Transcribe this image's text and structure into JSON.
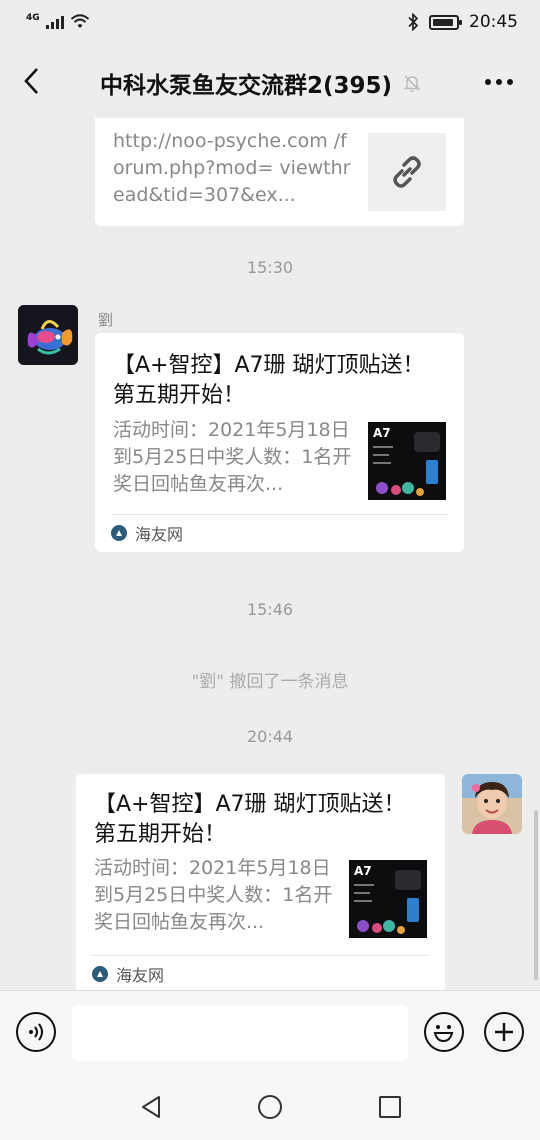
{
  "status_bar": {
    "network": "4G",
    "time": "20:45",
    "battery_level": 0.9
  },
  "nav": {
    "title": "中科水泵鱼友交流群2(395)"
  },
  "messages": {
    "link_card": {
      "url_text": "http://noo-psyche.com /forum.php?mod= viewthread&tid=307&ex..."
    },
    "time_1": "15:30",
    "msg_1": {
      "sender": "劉",
      "title": "【A+智控】A7珊 瑚灯顶贴送！第五期开始！",
      "desc": "活动时间：2021年5月18日到5月25日中奖人数：1名开奖日回帖鱼友再次...",
      "thumb_label": "A7",
      "source": "海友网"
    },
    "time_2": "15:46",
    "recall_text": "\"劉\" 撤回了一条消息",
    "time_3": "20:44",
    "msg_2": {
      "title": "【A+智控】A7珊 瑚灯顶贴送！第五期开始！",
      "desc": "活动时间：2021年5月18日到5月25日中奖人数：1名开奖日回帖鱼友再次...",
      "thumb_label": "A7",
      "source": "海友网"
    }
  },
  "colors": {
    "background": "#ededed",
    "card": "#ffffff",
    "muted_text": "#888888"
  }
}
